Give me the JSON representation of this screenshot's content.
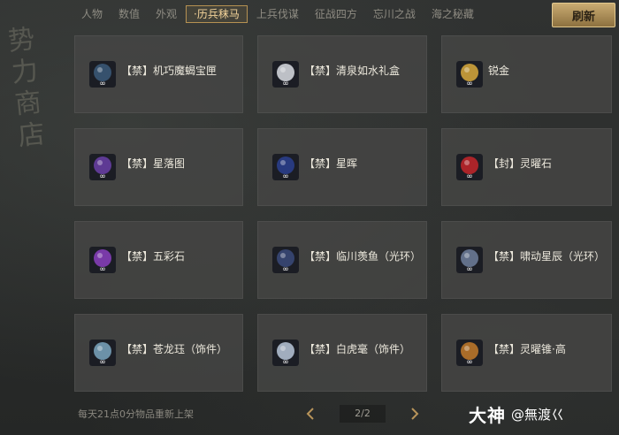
{
  "side_title": [
    "势",
    "力",
    "商",
    "店"
  ],
  "tabs": [
    {
      "label": "人物",
      "active": false
    },
    {
      "label": "数值",
      "active": false
    },
    {
      "label": "外观",
      "active": false
    },
    {
      "label": "·历兵秣马",
      "active": true
    },
    {
      "label": "上兵伐谋",
      "active": false
    },
    {
      "label": "征战四方",
      "active": false
    },
    {
      "label": "忘川之战",
      "active": false
    },
    {
      "label": "海之秘藏",
      "active": false
    }
  ],
  "refresh_label": "刷新",
  "items": [
    {
      "name": "【禁】机巧魔蝎宝匣",
      "icon": "mechanical-scorpion-box-icon",
      "accent": "#3b5a7a"
    },
    {
      "name": "【禁】清泉如水礼盒",
      "icon": "white-robe-gift-box-icon",
      "accent": "#d9dde3"
    },
    {
      "name": "锐金",
      "icon": "gold-ingot-icon",
      "accent": "#d8a93c"
    },
    {
      "name": "【禁】星落图",
      "icon": "star-fall-chart-icon",
      "accent": "#6a3fa8"
    },
    {
      "name": "【禁】星晖",
      "icon": "star-radiance-icon",
      "accent": "#2a3f8f"
    },
    {
      "name": "【封】灵曜石",
      "icon": "red-spirit-stone-icon",
      "accent": "#c4262a"
    },
    {
      "name": "【禁】五彩石",
      "icon": "rainbow-stone-icon",
      "accent": "#8a3fbf"
    },
    {
      "name": "【禁】临川羡鱼（光环）",
      "icon": "fish-halo-icon",
      "accent": "#3a4a7a"
    },
    {
      "name": "【禁】啸动星辰（光环）",
      "icon": "star-halo-icon",
      "accent": "#6f7f9c"
    },
    {
      "name": "【禁】苍龙珏（饰件）",
      "icon": "azure-dragon-jade-icon",
      "accent": "#7aa6c0"
    },
    {
      "name": "【禁】白虎毫（饰件）",
      "icon": "white-tiger-brush-icon",
      "accent": "#b8c7d9"
    },
    {
      "name": "【禁】灵曜锥·高",
      "icon": "spirit-awl-icon",
      "accent": "#c27a2a"
    }
  ],
  "footer_note": "每天21点0分物品重新上架",
  "pagination": {
    "text": "2/2"
  },
  "watermark": {
    "brand": "大神",
    "user": "@無渡巜"
  }
}
